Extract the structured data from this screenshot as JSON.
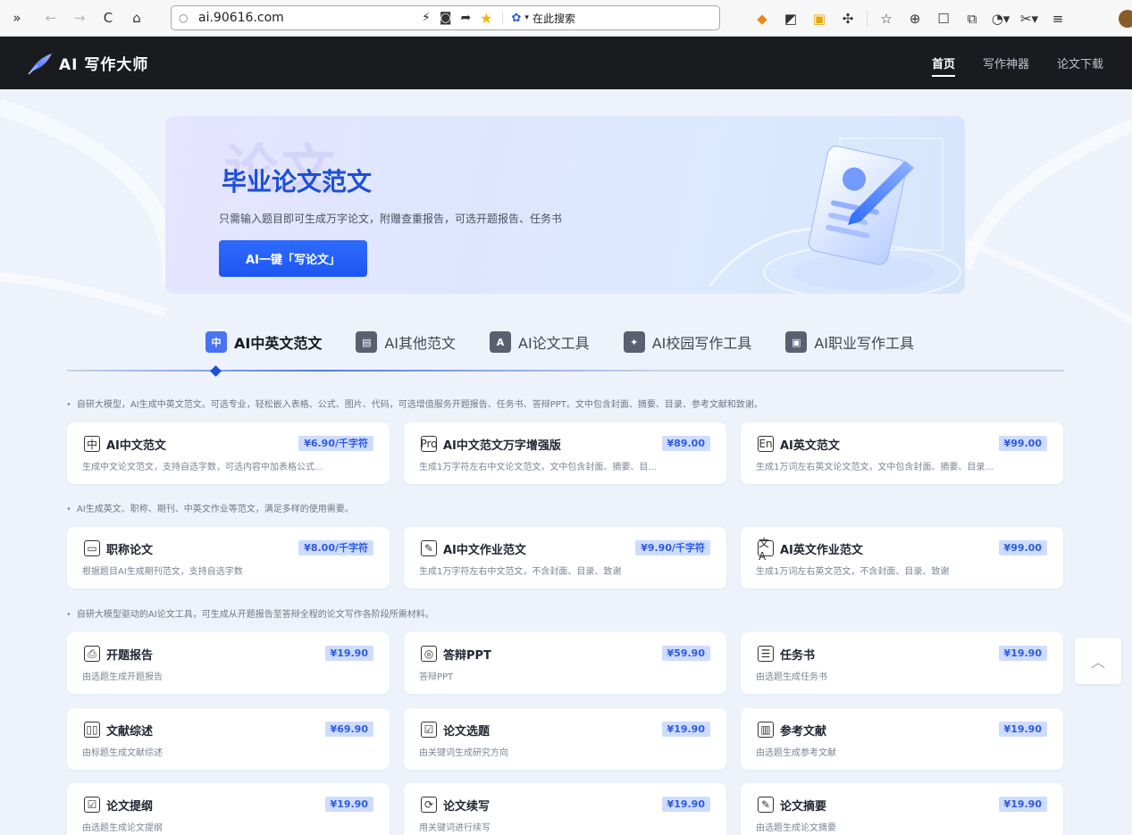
{
  "browser": {
    "url": "ai.90616.com",
    "search_engine_label": "在此搜索",
    "icons": [
      "double-chevron-icon",
      "back-arrow-icon",
      "forward-arrow-icon",
      "reload-icon",
      "home-icon",
      "search-icon",
      "lightning-icon",
      "shield-icon",
      "share-icon",
      "star-icon",
      "paw-icon",
      "extension-icons",
      "bookmark-icon",
      "download-icon",
      "window-icon",
      "split-screen-icon",
      "history-icon",
      "scissors-icon",
      "menu-icon",
      "avatar"
    ]
  },
  "site": {
    "logo_text": "AI 写作大师",
    "nav": [
      "首页",
      "写作神器",
      "论文下载"
    ],
    "active_nav": "首页"
  },
  "banner": {
    "watermark": "论文",
    "title": "毕业论文范文",
    "subtitle": "只需输入题目即可生成万字论文，附赠查重报告，可选开题报告、任务书",
    "button": "AI一键「写论文」"
  },
  "tabs": [
    {
      "label": "AI中英文范文",
      "icon": "chinese-english-icon",
      "active": true
    },
    {
      "label": "AI其他范文",
      "icon": "document-stack-icon",
      "active": false
    },
    {
      "label": "AI论文工具",
      "icon": "ai-tool-icon",
      "active": false
    },
    {
      "label": "AI校园写作工具",
      "icon": "graduation-cap-icon",
      "active": false
    },
    {
      "label": "AI职业写作工具",
      "icon": "briefcase-icon",
      "active": false
    }
  ],
  "notes": [
    "自研大模型，AI生成中英文范文。可选专业，轻松嵌入表格、公式、图片、代码，可选增值服务开题报告、任务书、答辩PPT。文中包含封面、摘要、目录、参考文献和致谢。",
    "AI生成英文、职称、期刊、中英文作业等范文，满足多样的使用需要。",
    "自研大模型驱动的AI论文工具，可生成从开题报告至答辩全程的论文写作各阶段所需材料。"
  ],
  "cards": [
    {
      "title": "AI中文范文",
      "price": "¥6.90/千字符",
      "desc": "生成中文论文范文，支持自选字数，可选内容中加表格公式...",
      "icon": "chinese-char-icon",
      "glyph": "中"
    },
    {
      "title": "AI中文范文万字增强版",
      "price": "¥89.00",
      "desc": "生成1万字符左右中文论文范文，文中包含封面、摘要、目...",
      "icon": "pro-icon",
      "glyph": "Pro"
    },
    {
      "title": "AI英文范文",
      "price": "¥99.00",
      "desc": "生成1万词左右英文论文范文，文中包含封面、摘要、目录...",
      "icon": "english-icon",
      "glyph": "En"
    },
    {
      "title": "职称论文",
      "price": "¥8.00/千字符",
      "desc": "根据题目AI生成期刊范文，支持自选字数",
      "icon": "monitor-icon",
      "glyph": "▭"
    },
    {
      "title": "AI中文作业范文",
      "price": "¥9.90/千字符",
      "desc": "生成1万字符左右中文范文，不含封面、目录、致谢",
      "icon": "edit-document-icon",
      "glyph": "✎"
    },
    {
      "title": "AI英文作业范文",
      "price": "¥99.00",
      "desc": "生成1万词左右英文范文，不含封面、目录、致谢",
      "icon": "translate-icon",
      "glyph": "文A"
    },
    {
      "title": "开题报告",
      "price": "¥19.90",
      "desc": "由选题生成开题报告",
      "icon": "report-icon",
      "glyph": "⎙"
    },
    {
      "title": "答辩PPT",
      "price": "¥59.90",
      "desc": "答辩PPT",
      "icon": "ppt-icon",
      "glyph": "◎"
    },
    {
      "title": "任务书",
      "price": "¥19.90",
      "desc": "由选题生成任务书",
      "icon": "task-book-icon",
      "glyph": "☰"
    },
    {
      "title": "文献综述",
      "price": "¥69.90",
      "desc": "由标题生成文献综述",
      "icon": "open-book-icon",
      "glyph": "▯▯"
    },
    {
      "title": "论文选题",
      "price": "¥19.90",
      "desc": "由关键词生成研究方向",
      "icon": "checklist-icon",
      "glyph": "☑"
    },
    {
      "title": "参考文献",
      "price": "¥19.90",
      "desc": "由选题生成参考文献",
      "icon": "library-icon",
      "glyph": "▥"
    },
    {
      "title": "论文提纲",
      "price": "¥19.90",
      "desc": "由选题生成论文提纲",
      "icon": "outline-icon",
      "glyph": "☑"
    },
    {
      "title": "论文续写",
      "price": "¥19.90",
      "desc": "用关键词进行续写",
      "icon": "continue-icon",
      "glyph": "⟳"
    },
    {
      "title": "论文摘要",
      "price": "¥19.90",
      "desc": "由选题生成论文摘要",
      "icon": "abstract-icon",
      "glyph": "✎"
    }
  ],
  "back_to_top_icon": "chevron-up-icon",
  "colors": {
    "accent": "#1d4fd8",
    "header_bg": "#1a1b1e",
    "price_bg": "#cfdcff",
    "price_text": "#2b5be0"
  }
}
